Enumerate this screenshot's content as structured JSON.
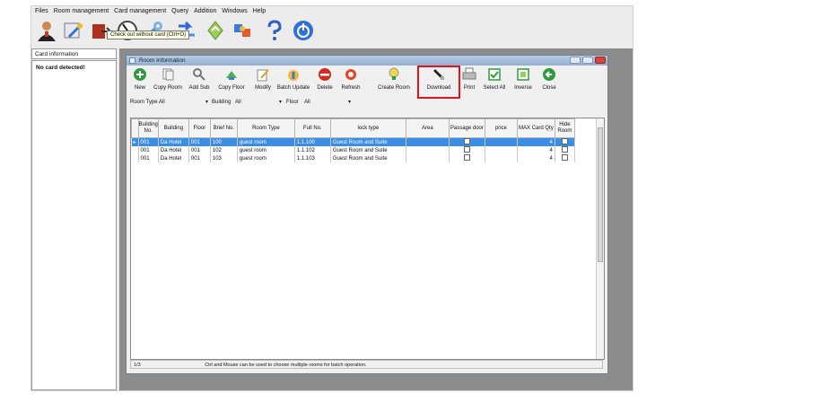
{
  "menu": {
    "items": [
      "Files",
      "Room management",
      "Card management",
      "Query",
      "Addition",
      "Windows",
      "Help"
    ]
  },
  "toolbar": {
    "icons": [
      "user-icon",
      "card-icon",
      "checkout-icon",
      "dial-icon",
      "wrench-icon",
      "arrow-icon",
      "recycle-icon",
      "puzzle-icon",
      "help-icon",
      "power-icon"
    ],
    "tooltip": "Check out without card (Ctrl+O)"
  },
  "left": {
    "tab": "Card information",
    "message": "No card detected!"
  },
  "window": {
    "title": "Room Information",
    "tools": [
      "New",
      "Copy Room",
      "Add Sub",
      "Copy Floor",
      "Modify",
      "Batch Update",
      "Delete",
      "Refresh",
      "Create Room",
      "Download",
      "Print",
      "Select All",
      "Inverse",
      "Close"
    ],
    "highlight": "Download"
  },
  "filters": {
    "room_type_label": "Room Type",
    "room_type_value": "All",
    "building_label": "Building",
    "building_value": "All",
    "floor_label": "Floor",
    "floor_value": "All"
  },
  "table": {
    "columns": [
      "Building No.",
      "Building",
      "Floor",
      "Brief No.",
      "Room Type",
      "Full No.",
      "lock type",
      "Area",
      "Passage door",
      "price",
      "MAX Card Qty",
      "Hide Room"
    ],
    "rows": [
      {
        "building_no": "001",
        "building": "Da Hotel",
        "floor": "001",
        "brief_no": "100",
        "room_type": "guest room",
        "full_no": "1.1.100",
        "lock_type": "Guest Room and Suite",
        "area": "",
        "passage": false,
        "price": "",
        "max_card": "4",
        "hide": false,
        "selected": true
      },
      {
        "building_no": "001",
        "building": "Da Hotel",
        "floor": "001",
        "brief_no": "102",
        "room_type": "guest room",
        "full_no": "1.1.102",
        "lock_type": "Guest Room and Suite",
        "area": "",
        "passage": false,
        "price": "",
        "max_card": "4",
        "hide": false,
        "selected": false
      },
      {
        "building_no": "001",
        "building": "Da Hotel",
        "floor": "001",
        "brief_no": "103",
        "room_type": "guest room",
        "full_no": "1.1.103",
        "lock_type": "Guest Room and Suite",
        "area": "",
        "passage": false,
        "price": "",
        "max_card": "4",
        "hide": false,
        "selected": false
      }
    ]
  },
  "status": {
    "count": "1/3",
    "hint": "Ctrl and Mouse can be used to choose multiple rooms for batch operation."
  }
}
